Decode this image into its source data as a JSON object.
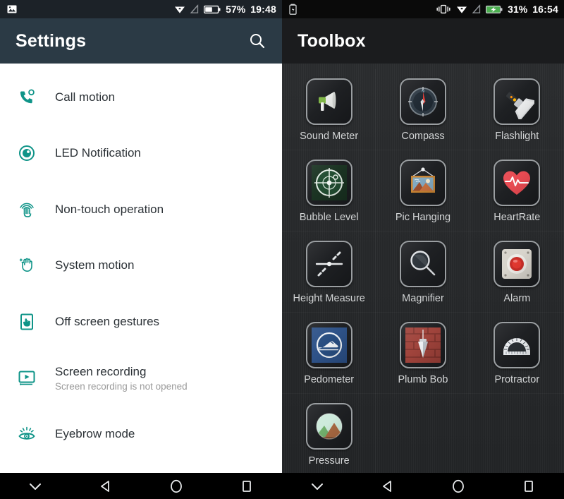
{
  "left_screen": {
    "statusbar": {
      "left_icons": [
        "image-icon"
      ],
      "right_icons": [
        "wifi-icon",
        "signal-off-icon",
        "battery-icon"
      ],
      "battery_percent": "57%",
      "time": "19:48"
    },
    "appbar": {
      "title": "Settings",
      "search_icon": "search-icon"
    },
    "settings": [
      {
        "icon": "call-motion-icon",
        "title": "Call motion",
        "subtitle": ""
      },
      {
        "icon": "led-notification-icon",
        "title": "LED Notification",
        "subtitle": ""
      },
      {
        "icon": "non-touch-operation-icon",
        "title": "Non-touch operation",
        "subtitle": ""
      },
      {
        "icon": "system-motion-icon",
        "title": "System motion",
        "subtitle": ""
      },
      {
        "icon": "off-screen-gestures-icon",
        "title": "Off screen gestures",
        "subtitle": ""
      },
      {
        "icon": "screen-recording-icon",
        "title": "Screen recording",
        "subtitle": "Screen recording is not opened"
      },
      {
        "icon": "eyebrow-mode-icon",
        "title": "Eyebrow mode",
        "subtitle": ""
      }
    ],
    "navbar": [
      "chevron-down-icon",
      "back-icon",
      "home-icon",
      "recents-icon"
    ]
  },
  "right_screen": {
    "statusbar": {
      "left_icons": [
        "battery-alert-icon"
      ],
      "right_icons": [
        "vibrate-icon",
        "wifi-icon",
        "signal-off-icon",
        "battery-charging-icon"
      ],
      "battery_percent": "31%",
      "time": "16:54"
    },
    "appbar": {
      "title": "Toolbox"
    },
    "tools": [
      {
        "icon": "sound-meter-icon",
        "label": "Sound Meter"
      },
      {
        "icon": "compass-icon",
        "label": "Compass"
      },
      {
        "icon": "flashlight-icon",
        "label": "Flashlight"
      },
      {
        "icon": "bubble-level-icon",
        "label": "Bubble Level"
      },
      {
        "icon": "pic-hanging-icon",
        "label": "Pic Hanging"
      },
      {
        "icon": "heart-rate-icon",
        "label": "HeartRate"
      },
      {
        "icon": "height-measure-icon",
        "label": "Height Measure"
      },
      {
        "icon": "magnifier-icon",
        "label": "Magnifier"
      },
      {
        "icon": "alarm-icon",
        "label": "Alarm"
      },
      {
        "icon": "pedometer-icon",
        "label": "Pedometer"
      },
      {
        "icon": "plumb-bob-icon",
        "label": "Plumb Bob"
      },
      {
        "icon": "protractor-icon",
        "label": "Protractor"
      },
      {
        "icon": "pressure-icon",
        "label": "Pressure"
      }
    ],
    "navbar": [
      "chevron-down-icon",
      "back-icon",
      "home-icon",
      "recents-icon"
    ]
  },
  "colors": {
    "settings_icon_teal": "#0f9488",
    "settings_appbar": "#2b3a45",
    "toolbox_appbar": "#1b1c1e",
    "toolbox_background": "#242628",
    "battery_charging_green": "#4caf50"
  }
}
